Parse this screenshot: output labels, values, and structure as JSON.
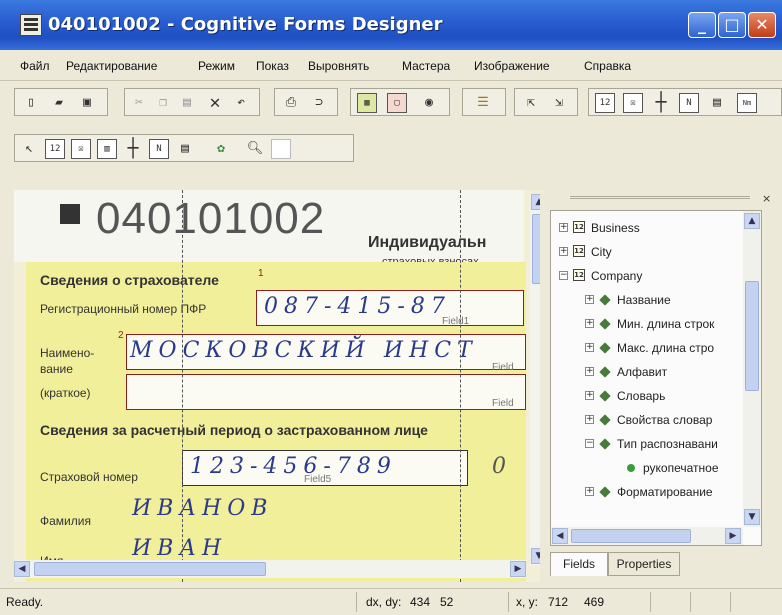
{
  "window": {
    "title": "040101002 - Cognitive Forms Designer"
  },
  "menu": [
    "Файл",
    "Редактирование",
    "Режим",
    "Показ",
    "Выровнять",
    "Мастера",
    "Изображение",
    "Справка"
  ],
  "toolbar_row1": [
    "new-icon",
    "open-icon",
    "save-icon",
    "cut-icon",
    "copy-icon",
    "paste-icon",
    "delete-icon",
    "undo-icon",
    "print-icon",
    "print-preview-icon",
    "image-icon",
    "form-icon",
    "template-icon",
    "scan-icon",
    "export-icon",
    "import-icon",
    "text-field-icon",
    "checkbox-field-icon",
    "line-icon",
    "number-icon",
    "properties-icon",
    "name-icon"
  ],
  "toolbar_row2": [
    "pointer-icon",
    "text-field-icon",
    "checkbox-field-icon",
    "barcode-field-icon",
    "cross-icon",
    "number-icon",
    "properties-icon",
    "recognize-icon",
    "zoom-icon",
    "frame-icon"
  ],
  "document": {
    "form_code": "040101002",
    "header_title": "Индивидуальн",
    "header_sub": "страховых взносах",
    "section1": "Сведения о страхователе",
    "section1_num": "1",
    "reg_label": "Регистрационный номер ПФР",
    "reg_value": "087-415-87",
    "field1_tag": "Field1",
    "name_label_1": "Наимено-",
    "name_label_2": "вание",
    "name_label_3": "(краткое)",
    "name_num": "2",
    "name_value": "МОСКОВСКИЙ ИНСТ",
    "field_tag_a": "Field",
    "field_tag_b": "Field",
    "section2": "Сведения за расчетный период о застрахованном лице",
    "ins_label": "Страховой номер",
    "ins_value": "123-456-789",
    "ins_tail": "0",
    "field5_tag": "Field5",
    "surname_label": "Фамилия",
    "surname_value": "ИВАНОВ",
    "firstname_label": "Имя",
    "firstname_value": "ИВАН"
  },
  "tree": {
    "nodes": [
      {
        "label": "Business",
        "level": 0,
        "expander": "+",
        "icon": "field-12-icon"
      },
      {
        "label": "City",
        "level": 0,
        "expander": "+",
        "icon": "field-12-icon"
      },
      {
        "label": "Company",
        "level": 0,
        "expander": "−",
        "icon": "field-12-icon"
      },
      {
        "label": "Название",
        "level": 1,
        "expander": "+",
        "icon": "pen-icon"
      },
      {
        "label": "Мин. длина строк",
        "level": 1,
        "expander": "+",
        "icon": "pen-icon"
      },
      {
        "label": "Макс. длина стро",
        "level": 1,
        "expander": "+",
        "icon": "pen-icon"
      },
      {
        "label": "Алфавит",
        "level": 1,
        "expander": "+",
        "icon": "pen-icon"
      },
      {
        "label": "Словарь",
        "level": 1,
        "expander": "+",
        "icon": "pen-icon"
      },
      {
        "label": "Свойства словар",
        "level": 1,
        "expander": "+",
        "icon": "pen-icon"
      },
      {
        "label": "Тип распознавани",
        "level": 1,
        "expander": "−",
        "icon": "pen-icon"
      },
      {
        "label": "рукопечатное",
        "level": 2,
        "expander": "",
        "icon": "green-dot-icon"
      },
      {
        "label": "Форматирование",
        "level": 1,
        "expander": "+",
        "icon": "pen-icon"
      }
    ],
    "tabs": [
      "Fields",
      "Properties"
    ],
    "active_tab": "Fields"
  },
  "status": {
    "ready": "Ready.",
    "dxdy_label": "dx, dy:",
    "dx": "434",
    "dy": "52",
    "xy_label": "x, y:",
    "x": "712",
    "y": "469"
  },
  "colors": {
    "titlebar": "#2a5fd1",
    "form_bg": "#f1ef9a",
    "cell_border": "#8a1f1f",
    "handwriting": "#2b3a8a"
  }
}
